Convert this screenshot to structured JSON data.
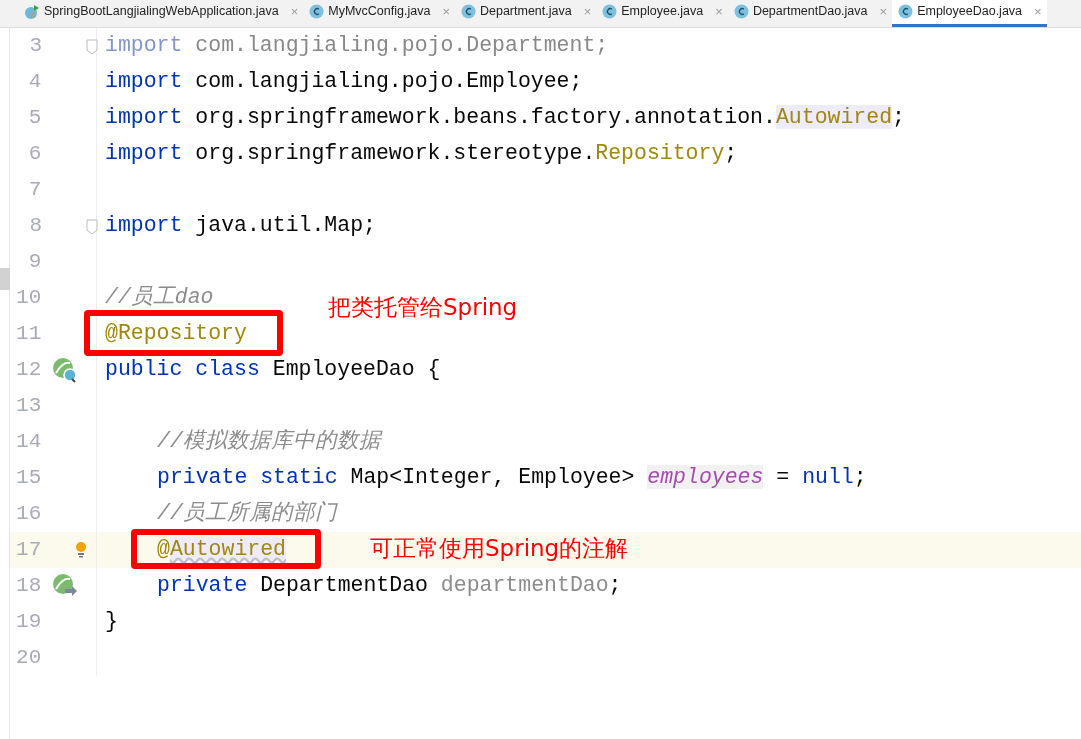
{
  "tabs": [
    {
      "label": "SpringBootLangjialingWebApplication.java",
      "kind": "app",
      "close": "×",
      "selected": false
    },
    {
      "label": "MyMvcConfig.java",
      "kind": "class",
      "close": "×",
      "selected": false
    },
    {
      "label": "Department.java",
      "kind": "class",
      "close": "×",
      "selected": false
    },
    {
      "label": "Employee.java",
      "kind": "class",
      "close": "×",
      "selected": false
    },
    {
      "label": "DepartmentDao.java",
      "kind": "class",
      "close": "×",
      "selected": false
    },
    {
      "label": "EmployeeDao.java",
      "kind": "class",
      "close": "×",
      "selected": true
    }
  ],
  "lines": [
    {
      "number": "3",
      "fold": true,
      "tokens": [
        {
          "kind": "kw-dim",
          "text": "import "
        },
        {
          "kind": "dim",
          "text": "com.langjialing.pojo.Department;"
        }
      ]
    },
    {
      "number": "4",
      "tokens": [
        {
          "kind": "kw",
          "text": "import "
        },
        {
          "kind": "plain",
          "text": "com.langjialing.pojo.Employee;"
        }
      ]
    },
    {
      "number": "5",
      "tokens": [
        {
          "kind": "kw",
          "text": "import "
        },
        {
          "kind": "plain",
          "text": "org.springframework.beans.factory.annotation."
        },
        {
          "kind": "ann",
          "text": "Autowired",
          "highlight": true
        },
        {
          "kind": "plain",
          "text": ";"
        }
      ]
    },
    {
      "number": "6",
      "tokens": [
        {
          "kind": "kw",
          "text": "import "
        },
        {
          "kind": "plain",
          "text": "org.springframework.stereotype."
        },
        {
          "kind": "ann",
          "text": "Repository"
        },
        {
          "kind": "plain",
          "text": ";"
        }
      ]
    },
    {
      "number": "7"
    },
    {
      "number": "8",
      "fold": true,
      "tokens": [
        {
          "kind": "kw",
          "text": "import "
        },
        {
          "kind": "plain",
          "text": "java.util.Map;"
        }
      ]
    },
    {
      "number": "9"
    },
    {
      "number": "10",
      "tokens": [
        {
          "kind": "comment",
          "text": "//员工dao"
        }
      ]
    },
    {
      "number": "11",
      "tokens": [
        {
          "kind": "ann",
          "text": "@Repository"
        }
      ]
    },
    {
      "number": "12",
      "gutter": {
        "kind": "bean-class"
      },
      "tokens": [
        {
          "kind": "kw",
          "text": "public class "
        },
        {
          "kind": "plain",
          "text": "EmployeeDao {"
        }
      ]
    },
    {
      "number": "13"
    },
    {
      "number": "14",
      "indented": true,
      "tokens": [
        {
          "kind": "comment",
          "text": "//模拟数据库中的数据"
        }
      ]
    },
    {
      "number": "15",
      "indented": true,
      "tokens": [
        {
          "kind": "kw",
          "text": "private static "
        },
        {
          "kind": "plain",
          "text": "Map<Integer, Employee> "
        },
        {
          "kind": "field",
          "text": "employees"
        },
        {
          "kind": "plain",
          "text": " = "
        },
        {
          "kind": "kw",
          "text": "null"
        },
        {
          "kind": "plain",
          "text": ";"
        }
      ]
    },
    {
      "number": "16",
      "indented": true,
      "tokens": [
        {
          "kind": "comment",
          "text": "//员工所属的部门"
        }
      ]
    },
    {
      "number": "17",
      "indented": true,
      "current": true,
      "gutter": {
        "kind": "bulb"
      },
      "tokens": [
        {
          "kind": "ann",
          "text": "@"
        },
        {
          "kind": "ann",
          "text": "Autowired",
          "highlight": true,
          "squiggle": true
        }
      ]
    },
    {
      "number": "18",
      "indented": true,
      "gutter": {
        "kind": "bean-inject"
      },
      "tokens": [
        {
          "kind": "kw",
          "text": "private "
        },
        {
          "kind": "plain",
          "text": "DepartmentDao "
        },
        {
          "kind": "unused",
          "text": "departmentDao"
        },
        {
          "kind": "plain",
          "text": ";"
        }
      ]
    },
    {
      "number": "19",
      "tokens": [
        {
          "kind": "plain",
          "text": "}"
        }
      ]
    },
    {
      "number": "20"
    }
  ],
  "annotations": [
    {
      "text": "把类托管给Spring"
    },
    {
      "text": "可正常使用Spring的注解"
    }
  ]
}
